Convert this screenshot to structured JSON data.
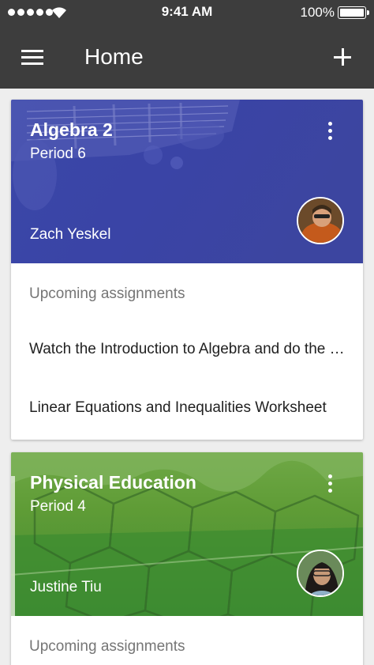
{
  "status_bar": {
    "time": "9:41 AM",
    "battery": "100%"
  },
  "app_bar": {
    "title": "Home"
  },
  "colors": {
    "app_bar": "#3d3d3d",
    "algebra_header": "#3f48a8",
    "pe_header": "#5f9e3a"
  },
  "classes": [
    {
      "name": "Algebra 2",
      "period": "Period 6",
      "teacher": "Zach Yeskel",
      "section_label": "Upcoming assignments",
      "assignments": [
        "Watch the Introduction to Algebra and do the exercises",
        "Linear Equations and Inequalities Worksheet"
      ]
    },
    {
      "name": "Physical Education",
      "period": "Period 4",
      "teacher": "Justine Tiu",
      "section_label": "Upcoming assignments"
    }
  ]
}
